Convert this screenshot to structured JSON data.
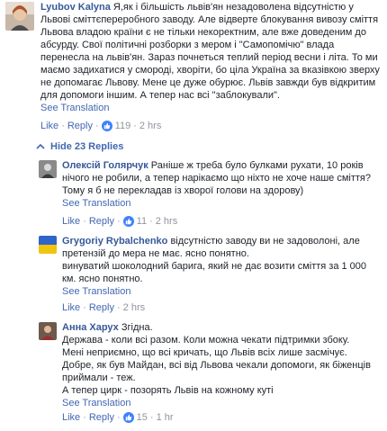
{
  "main_comment": {
    "author": "Lyubov Kalyna",
    "text": "Я,як і більшість львів'ян незадоволена відсутністю у Львові сміттєпереробного заводу. Але відверте блокування вивозу сміття Львова владою країни є не тільки некоректним, але вже доведеним до абсурду. Свої політичні розборки з мером і \"Самопомічю\" влада перенесла на львів'ян. Зараз почнеться теплий період весни і літа. То ми маємо задихатися у смороді, хворіти, бо ціла Україна за вказівкою зверху не допомагає Львову. Мене це дуже обурює. Львів завжди був відкритим для допомоги іншим. А тепер нас всі \"заблокували\".",
    "see_translation": "See Translation",
    "like": "Like",
    "reply": "Reply",
    "reactions": "119",
    "time": "2 hrs"
  },
  "hide_replies": "Hide 23 Replies",
  "replies": [
    {
      "author": "Олексій Голярчук",
      "text": "Раніше ж треба було булками рухати, 10 років нічого не робили, а тепер нарікаємо що ніхто не хоче наше сміття? Тому я б не перекладав із хворої голови на здорову)",
      "see_translation": "See Translation",
      "like": "Like",
      "reply": "Reply",
      "reactions": "11",
      "time": "2 hrs"
    },
    {
      "author": "Grygoriy Rybalchenko",
      "text": "відсутністю заводу ви не задоволоні, але претензій до мера не має. ясно понятно.",
      "text2": "винуватий шоколодний барига, який не дає возити сміття за 1 000 км. ясно понятно.",
      "see_translation": "See Translation",
      "like": "Like",
      "reply": "Reply",
      "reactions": "",
      "time": "2 hrs"
    },
    {
      "author": "Анна Харух",
      "text": "Згідна.",
      "lines": [
        "Держава - коли всі разом. Коли можна чекати підтримки збоку.",
        "Мені неприємно, що всі кричать, що Львів всіх лише засмічує.",
        "Добре, як був Майдан, всі від Львова чекали допомоги, як біженців приймали - теж.",
        "А тепер цирк - позорять Львів на кожному куті"
      ],
      "see_translation": "See Translation",
      "like": "Like",
      "reply": "Reply",
      "reactions": "15",
      "time": "1 hr"
    }
  ],
  "colors": {
    "link": "#4267b2",
    "author": "#365899",
    "meta": "#90949c",
    "like_badge": "#4080ff"
  }
}
